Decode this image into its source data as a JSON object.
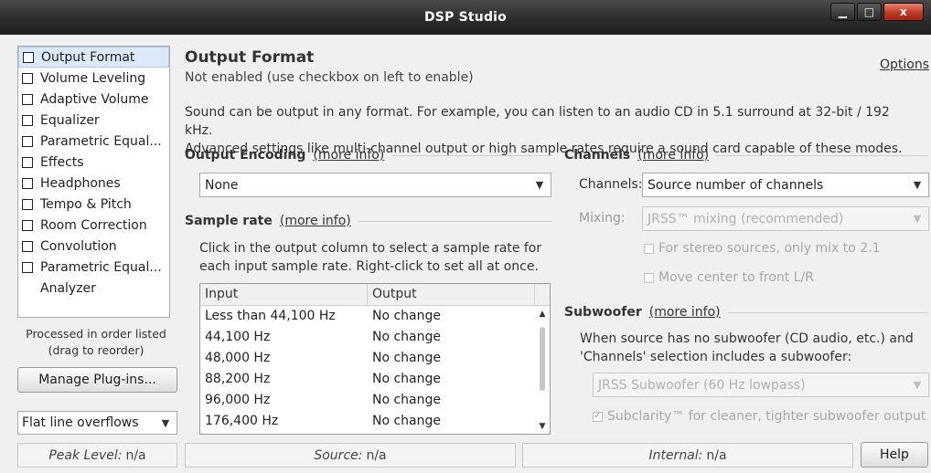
{
  "window": {
    "title": "DSP Studio",
    "controls": {
      "minimize": "▁",
      "maximize": "□",
      "close": "x"
    }
  },
  "sidebar": {
    "items": [
      {
        "label": "Output Format",
        "checkbox": true,
        "selected": true
      },
      {
        "label": "Volume Leveling",
        "checkbox": true
      },
      {
        "label": "Adaptive Volume",
        "checkbox": true
      },
      {
        "label": "Equalizer",
        "checkbox": true
      },
      {
        "label": "Parametric Equal...",
        "checkbox": true
      },
      {
        "label": "Effects",
        "checkbox": true
      },
      {
        "label": "Headphones",
        "checkbox": true
      },
      {
        "label": "Tempo & Pitch",
        "checkbox": true
      },
      {
        "label": "Room Correction",
        "checkbox": true
      },
      {
        "label": "Convolution",
        "checkbox": true
      },
      {
        "label": "Parametric Equal...",
        "checkbox": true
      },
      {
        "label": "Analyzer",
        "checkbox": false
      }
    ],
    "order_note_line1": "Processed in order listed",
    "order_note_line2": "(drag to reorder)",
    "manage_button": "Manage Plug-ins...",
    "overflow_select": "Flat line overflows"
  },
  "main": {
    "title": "Output Format",
    "subtitle": "Not enabled (use checkbox on left to enable)",
    "options_link": "Options",
    "description_line1": "Sound can be output in any format.  For example, you can listen to an audio CD in 5.1 surround at 32-bit / 192 kHz.",
    "description_line2": "Advanced settings like multi-channel output or high sample rates require a sound card capable of these modes.",
    "output_encoding": {
      "heading": "Output Encoding",
      "more_info": "(more info)",
      "value": "None"
    },
    "sample_rate": {
      "heading": "Sample rate",
      "more_info": "(more info)",
      "desc_line1": "Click in the output column to select a sample rate for",
      "desc_line2": "each input sample rate.  Right-click to set all at once.",
      "columns": [
        "Input",
        "Output"
      ],
      "rows": [
        [
          "Less than 44,100 Hz",
          "No change"
        ],
        [
          "44,100 Hz",
          "No change"
        ],
        [
          "48,000 Hz",
          "No change"
        ],
        [
          "88,200 Hz",
          "No change"
        ],
        [
          "96,000 Hz",
          "No change"
        ],
        [
          "176,400 Hz",
          "No change"
        ]
      ]
    },
    "channels": {
      "heading": "Channels",
      "more_info": "(more info)",
      "channels_label": "Channels:",
      "channels_value": "Source number of channels",
      "mixing_label": "Mixing:",
      "mixing_value": "JRSS™ mixing (recommended)",
      "stereo_option": "For stereo sources, only mix to 2.1",
      "center_option": "Move center to front L/R"
    },
    "subwoofer": {
      "heading": "Subwoofer",
      "more_info": "(more info)",
      "desc_line1": "When source has no subwoofer (CD audio, etc.) and",
      "desc_line2": "'Channels' selection includes a subwoofer:",
      "value": "JRSS Subwoofer (60 Hz lowpass)",
      "subclarity": "Subclarity™ for cleaner, tighter subwoofer output"
    }
  },
  "statusbar": {
    "peak_label": "Peak Level:",
    "peak_value": "n/a",
    "source_label": "Source:",
    "source_value": "n/a",
    "internal_label": "Internal:",
    "internal_value": "n/a",
    "help_button": "Help"
  }
}
